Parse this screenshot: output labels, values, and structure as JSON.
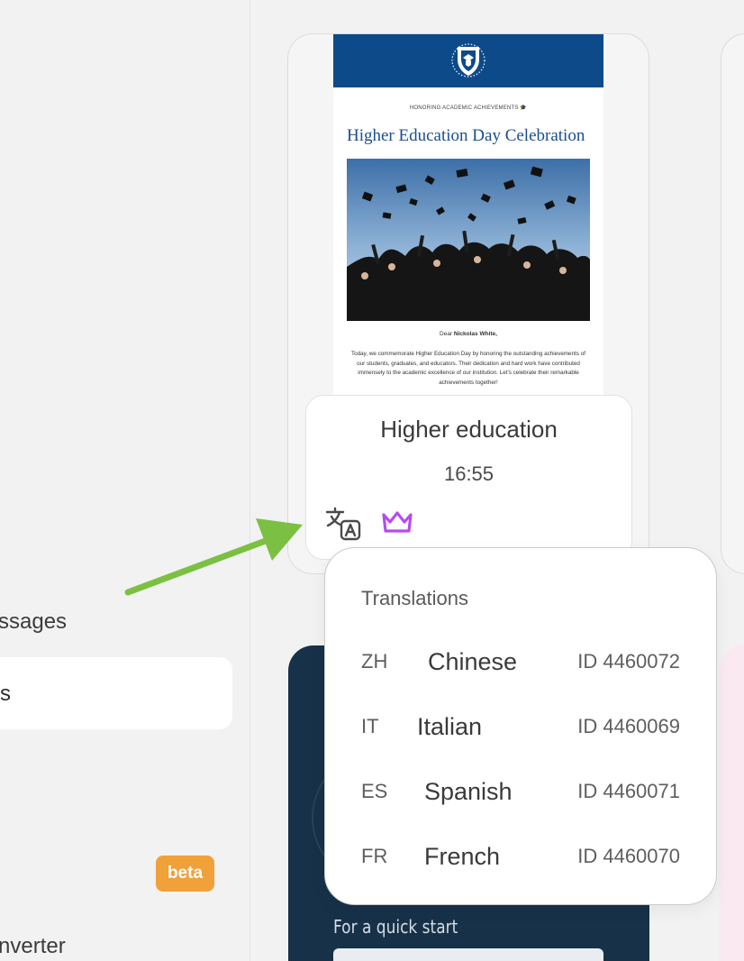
{
  "sidebar": {
    "item_messages_label": "ssages",
    "item_active_label": "s",
    "beta_badge": "beta",
    "item_converter_label": "nverter"
  },
  "template_card": {
    "email": {
      "subheading": "HONORING ACADEMIC ACHIEVEMENTS 🎓",
      "title": "Higher Education Day Celebration",
      "greeting_prefix": "Dear",
      "greeting_name": "Nickolas White,",
      "body": "Today, we commemorate Higher Education Day by honoring the outstanding achievements of our students, graduates, and educators. Their dedication and hard work have contributed immensely to the academic excellence of our institution. Let's celebrate their remarkable achievements together!"
    },
    "name": "Higher education",
    "time": "16:55",
    "icons": [
      "translate-icon",
      "crown-icon"
    ],
    "crown_color": "#b64bf0"
  },
  "translations_popover": {
    "title": "Translations",
    "items": [
      {
        "code": "ZH",
        "language": "Chinese",
        "id": "ID 4460072"
      },
      {
        "code": "IT",
        "language": "Italian",
        "id": "ID 4460069"
      },
      {
        "code": "ES",
        "language": "Spanish",
        "id": "ID 4460071"
      },
      {
        "code": "FR",
        "language": "French",
        "id": "ID 4460070"
      }
    ]
  },
  "dark_card": {
    "caption": "For a quick start"
  },
  "colors": {
    "email_header": "#0d4a8a",
    "beta_badge": "#f0a13a",
    "arrow": "#7cc043",
    "dark_card": "#173149"
  }
}
